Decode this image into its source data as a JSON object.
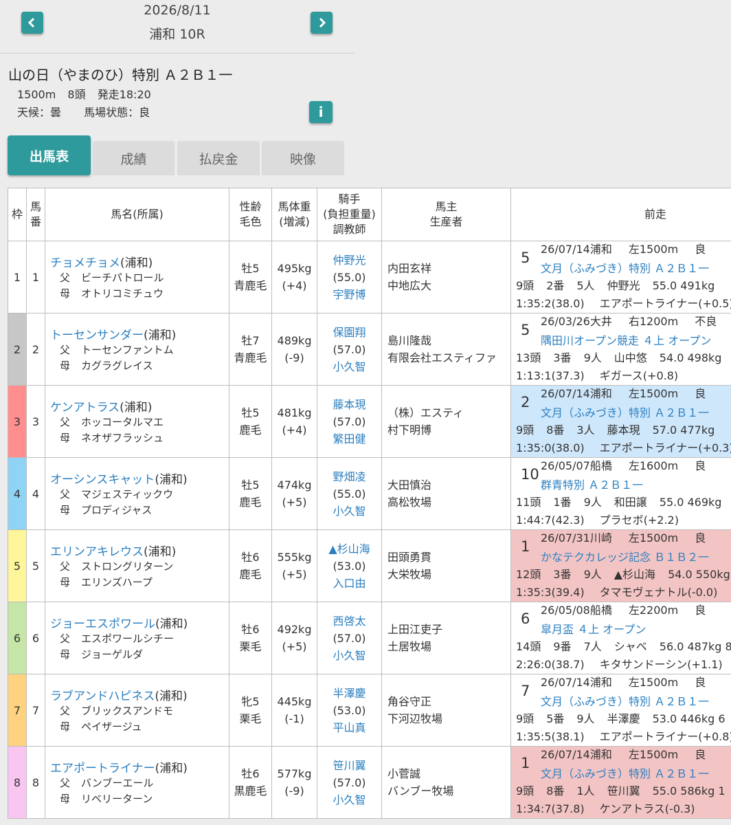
{
  "header": {
    "date": "2026/8/11",
    "race": "浦和 10R"
  },
  "race": {
    "title": "山の日（やまのひ）特別 Ａ２Ｂ１一",
    "distance": "1500m",
    "runners": "8頭",
    "start": "発走18:20",
    "weather": "天候：曇",
    "track": "馬場状態：良"
  },
  "tabs": [
    "出馬表",
    "成績",
    "払戻金",
    "映像"
  ],
  "columns": {
    "waku": "枠",
    "umaban": "馬番",
    "name": "馬名(所属)",
    "sexage1": "性齢",
    "sexage2": "毛色",
    "weight1": "馬体重",
    "weight2": "(増減)",
    "jockey1": "騎手",
    "jockey2": "(負担重量)",
    "jockey3": "調教師",
    "owner1": "馬主",
    "owner2": "生産者",
    "prev": "前走"
  },
  "colors": {
    "accent": "#2e9a9c",
    "link": "#2b7fc0",
    "win_bg": "#f3c4c4",
    "place_bg": "#cfe7fb"
  },
  "rows": [
    {
      "waku": "1",
      "umaban": "1",
      "wakucolor": "#ffffff",
      "name": "チョメチョメ",
      "aff": "(浦和)",
      "sire_label": "父",
      "sire": "ビーチパトロール",
      "dam_label": "母",
      "dam": "オトリコミチュウ",
      "sex": "牡5",
      "coat": "青鹿毛",
      "weight": "495kg",
      "diff": "(+4)",
      "jockey": "仲野光",
      "load": "(55.0)",
      "trainer": "宇野博",
      "owner": "内田玄祥",
      "breeder": "中地広大",
      "prev": {
        "rank": "5",
        "date": "26/07/14浦和",
        "course": "左1500m",
        "cond": "良",
        "race": "文月（ふみづき）特別 Ａ２Ｂ１一",
        "l3a": "9頭",
        "l3b": "2番",
        "l3c": "5人",
        "l3d": "仲野光",
        "l3e": "55.0 491kg",
        "time": "1:35:2(38.0)",
        "winner": "エアポートライナー(+0.5)",
        "bg": "#ffffff"
      }
    },
    {
      "waku": "2",
      "umaban": "2",
      "wakucolor": "#c7c7c7",
      "name": "トーセンサンダー",
      "aff": "(浦和)",
      "sire_label": "父",
      "sire": "トーセンファントム",
      "dam_label": "母",
      "dam": "カグラグレイス",
      "sex": "牡7",
      "coat": "青鹿毛",
      "weight": "489kg",
      "diff": "(-9)",
      "jockey": "保園翔",
      "load": "(57.0)",
      "trainer": "小久智",
      "owner": "島川隆哉",
      "breeder": "有限会社エスティファ",
      "prev": {
        "rank": "5",
        "date": "26/03/26大井",
        "course": "右1200m",
        "cond": "不良",
        "race": "隅田川オープン競走 ４上 オープン",
        "l3a": "13頭",
        "l3b": "3番",
        "l3c": "9人",
        "l3d": "山中悠",
        "l3e": "54.0 498kg",
        "time": "1:13:1(37.3)",
        "winner": "ギガース(+0.8)",
        "bg": "#ffffff"
      }
    },
    {
      "waku": "3",
      "umaban": "3",
      "wakucolor": "#ff8f8f",
      "name": "ケンアトラス",
      "aff": "(浦和)",
      "sire_label": "父",
      "sire": "ホッコータルマエ",
      "dam_label": "母",
      "dam": "ネオザフラッシュ",
      "sex": "牡5",
      "coat": "鹿毛",
      "weight": "481kg",
      "diff": "(+4)",
      "jockey": "藤本現",
      "load": "(57.0)",
      "trainer": "繁田健",
      "owner": "（株）エスティ",
      "breeder": "村下明博",
      "prev": {
        "rank": "2",
        "date": "26/07/14浦和",
        "course": "左1500m",
        "cond": "良",
        "race": "文月（ふみづき）特別 Ａ２Ｂ１一",
        "l3a": "9頭",
        "l3b": "8番",
        "l3c": "3人",
        "l3d": "藤本現",
        "l3e": "57.0 477kg",
        "time": "1:35:0(38.0)",
        "winner": "エアポートライナー(+0.3)",
        "bg": "#cfe7fb"
      }
    },
    {
      "waku": "4",
      "umaban": "4",
      "wakucolor": "#8fd3f5",
      "name": "オーシンスキャット",
      "aff": "(浦和)",
      "sire_label": "父",
      "sire": "マジェスティックウ",
      "dam_label": "母",
      "dam": "プロディジャス",
      "sex": "牡5",
      "coat": "鹿毛",
      "weight": "474kg",
      "diff": "(+5)",
      "jockey": "野畑凌",
      "load": "(55.0)",
      "trainer": "小久智",
      "owner": "大田慎治",
      "breeder": "高松牧場",
      "prev": {
        "rank": "10",
        "date": "26/05/07船橋",
        "course": "左1600m",
        "cond": "良",
        "race": "群青特別 Ａ２Ｂ１一",
        "l3a": "11頭",
        "l3b": "1番",
        "l3c": "9人",
        "l3d": "和田譲",
        "l3e": "55.0 469kg",
        "time": "1:44:7(42.3)",
        "winner": "プラセボ(+2.2)",
        "bg": "#ffffff"
      }
    },
    {
      "waku": "5",
      "umaban": "5",
      "wakucolor": "#fff59a",
      "name": "エリンアキレウス",
      "aff": "(浦和)",
      "sire_label": "父",
      "sire": "ストロングリターン",
      "dam_label": "母",
      "dam": "エリンズハープ",
      "sex": "牡6",
      "coat": "鹿毛",
      "weight": "555kg",
      "diff": "(+5)",
      "jockey": "▲杉山海",
      "load": "(53.0)",
      "trainer": "入口由",
      "owner": "田頭勇貫",
      "breeder": "大栄牧場",
      "prev": {
        "rank": "1",
        "date": "26/07/31川崎",
        "course": "左1500m",
        "cond": "良",
        "race": "かなテクカレッジ記念 Ｂ１Ｂ２一",
        "l3a": "12頭",
        "l3b": "3番",
        "l3c": "9人",
        "l3d": "▲杉山海",
        "l3e": "54.0 550kg",
        "time": "1:35:3(39.4)",
        "winner": "タマモヴェナトル(-0.0)",
        "bg": "#f3c4c4"
      }
    },
    {
      "waku": "6",
      "umaban": "6",
      "wakucolor": "#c5e6a6",
      "name": "ジョーエスポワール",
      "aff": "(浦和)",
      "sire_label": "父",
      "sire": "エスポワールシチー",
      "dam_label": "母",
      "dam": "ジョーゲルダ",
      "sex": "牡6",
      "coat": "栗毛",
      "weight": "492kg",
      "diff": "(+5)",
      "jockey": "西啓太",
      "load": "(57.0)",
      "trainer": "小久智",
      "owner": "上田江吏子",
      "breeder": "土居牧場",
      "prev": {
        "rank": "6",
        "date": "26/05/08船橋",
        "course": "左2200m",
        "cond": "良",
        "race": "皐月盃 ４上 オープン",
        "l3a": "14頭",
        "l3b": "9番",
        "l3c": "7人",
        "l3d": "シャベ",
        "l3e": "56.0 487kg 8",
        "time": "2:26:0(38.7)",
        "winner": "キタサンドーシン(+1.1)",
        "bg": "#ffffff"
      }
    },
    {
      "waku": "7",
      "umaban": "7",
      "wakucolor": "#ffd27f",
      "name": "ラブアンドハピネス",
      "aff": "(浦和)",
      "sire_label": "父",
      "sire": "ブリックスアンドモ",
      "dam_label": "母",
      "dam": "ペイザージュ",
      "sex": "牝5",
      "coat": "栗毛",
      "weight": "445kg",
      "diff": "(-1)",
      "jockey": "半澤慶",
      "load": "(53.0)",
      "trainer": "平山真",
      "owner": "角谷守正",
      "breeder": "下河辺牧場",
      "prev": {
        "rank": "7",
        "date": "26/07/14浦和",
        "course": "左1500m",
        "cond": "良",
        "race": "文月（ふみづき）特別 Ａ２Ｂ１一",
        "l3a": "9頭",
        "l3b": "5番",
        "l3c": "9人",
        "l3d": "半澤慶",
        "l3e": "53.0 446kg 6",
        "time": "1:35:5(38.1)",
        "winner": "エアポートライナー(+0.8)",
        "bg": "#ffffff"
      }
    },
    {
      "waku": "8",
      "umaban": "8",
      "wakucolor": "#f9c6f2",
      "name": "エアポートライナー",
      "aff": "(浦和)",
      "sire_label": "父",
      "sire": "バンブーエール",
      "dam_label": "母",
      "dam": "リベリーターン",
      "sex": "牡6",
      "coat": "黒鹿毛",
      "weight": "577kg",
      "diff": "(-9)",
      "jockey": "笹川翼",
      "load": "(57.0)",
      "trainer": "小久智",
      "owner": "小菅誠",
      "breeder": "バンブー牧場",
      "prev": {
        "rank": "1",
        "date": "26/07/14浦和",
        "course": "左1500m",
        "cond": "良",
        "race": "文月（ふみづき）特別 Ａ２Ｂ１一",
        "l3a": "9頭",
        "l3b": "8番",
        "l3c": "1人",
        "l3d": "笹川翼",
        "l3e": "55.0 586kg 1",
        "time": "1:34:7(37.8)",
        "winner": "ケンアトラス(-0.3)",
        "bg": "#f3c4c4"
      }
    }
  ]
}
